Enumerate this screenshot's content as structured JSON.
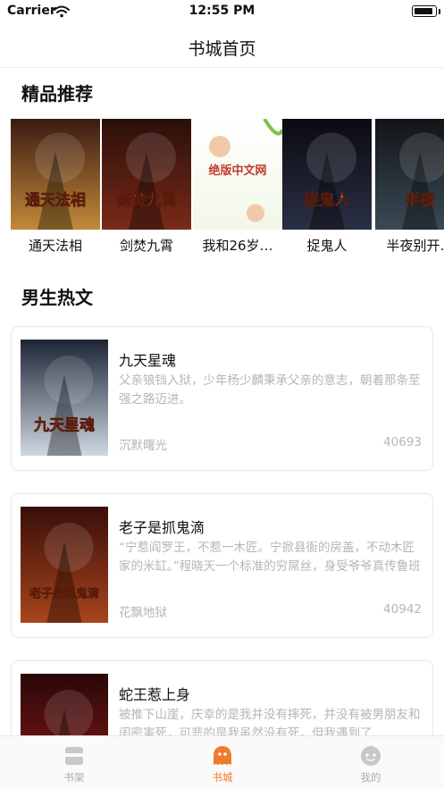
{
  "status_bar": {
    "carrier": "Carrier",
    "time": "12:55 PM",
    "battery_level": 0.9
  },
  "nav": {
    "title": "书城首页"
  },
  "featured": {
    "heading": "精品推荐",
    "books": [
      {
        "title": "通天法相",
        "cover_text": "通天法相",
        "cover_colors": [
          "#3a1a12",
          "#c28a3a"
        ]
      },
      {
        "title": "剑焚九霄",
        "cover_text": "剑焚九霄",
        "cover_colors": [
          "#2a0f0a",
          "#7a2a18"
        ]
      },
      {
        "title": "我和26岁…",
        "cover_text": "绝版中文网",
        "cover_colors": [
          "#ffffff",
          "#f3f7e8"
        ]
      },
      {
        "title": "捉鬼人",
        "cover_text": "捉鬼人",
        "cover_colors": [
          "#0a0a12",
          "#2a2f44"
        ]
      },
      {
        "title": "半夜别开…",
        "cover_text": "半夜",
        "cover_colors": [
          "#121418",
          "#3a4a55"
        ]
      }
    ]
  },
  "hot": {
    "heading": "男生热文",
    "books": [
      {
        "title": "九天星魂",
        "description": "父亲锒铛入狱，少年杨少麟秉承父亲的意志，朝着那条至强之路迈进。",
        "author": "沉默曙光",
        "count": "40693",
        "cover_text": "九天星魂",
        "cover_colors": [
          "#1d2535",
          "#cfd7e3"
        ]
      },
      {
        "title": "老子是抓鬼滴",
        "description": "“宁惹阎罗王，不惹一木匠。宁掀县衙的房盖，不动木匠家的米缸。”程晓天一个标准的穷屌丝，身受爷爷真传鲁班秘术。因为朋友一场诡异的车祸，坐车…",
        "author": "花飘地狱",
        "count": "40942",
        "cover_text": "老子是抓鬼滴",
        "cover_colors": [
          "#3a0e0a",
          "#a8451c"
        ]
      },
      {
        "title": "蛇王惹上身",
        "description": "被推下山崖，庆幸的是我并没有摔死，并没有被男朋友和闺密害死，可悲的是我虽然没有死，但我遇到了",
        "author": "",
        "count": "",
        "cover_text": "",
        "cover_colors": [
          "#2a0808",
          "#8a1818"
        ]
      }
    ]
  },
  "tabs": [
    {
      "label": "书架",
      "icon": "bookshelf-icon"
    },
    {
      "label": "书城",
      "icon": "bookstore-icon"
    },
    {
      "label": "我的",
      "icon": "profile-icon"
    }
  ],
  "active_tab": "书城",
  "colors": {
    "accent": "#f07b2d",
    "muted_text": "#b5b5b5",
    "tab_inactive": "#aaaaaa"
  }
}
